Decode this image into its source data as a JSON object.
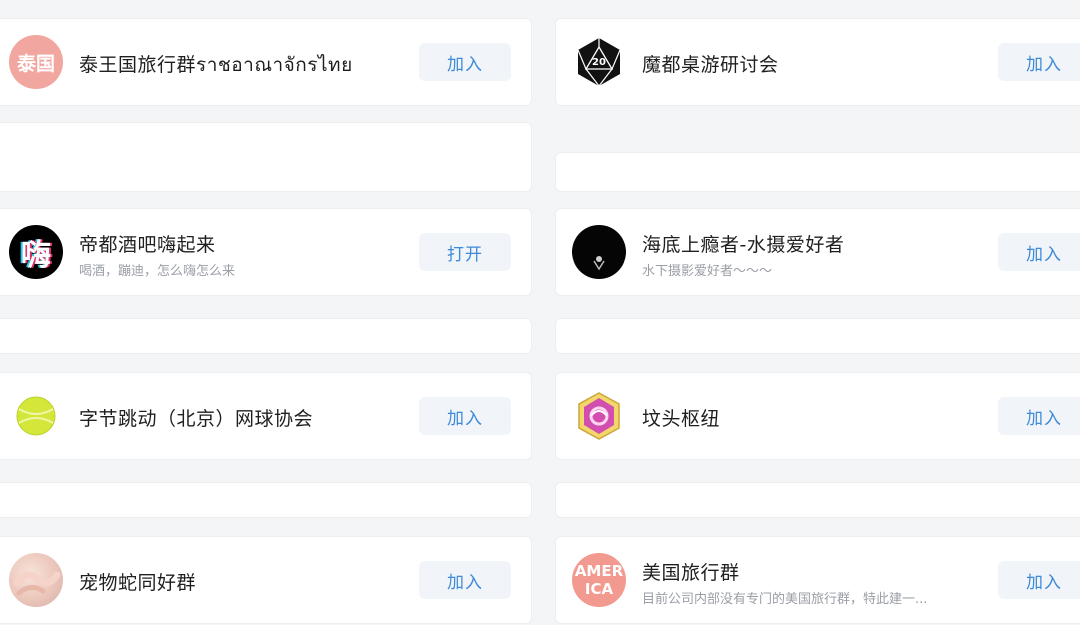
{
  "groups_left": [
    {
      "title": "泰王国旅行群ราชอาณาจักรไทย",
      "subtitle": "",
      "avatar_text": "泰国",
      "button": "加入"
    },
    {
      "title": "帝都酒吧嗨起来",
      "subtitle": "喝酒，蹦迪，怎么嗨怎么来",
      "avatar_text": "嗨",
      "button": "打开"
    },
    {
      "title": "字节跳动（北京）网球协会",
      "subtitle": "",
      "avatar_text": "",
      "button": "加入"
    },
    {
      "title": "宠物蛇同好群",
      "subtitle": "",
      "avatar_text": "",
      "button": "加入"
    }
  ],
  "groups_right": [
    {
      "title": "魔都桌游研讨会",
      "subtitle": "",
      "avatar_text": "20",
      "button": "加入"
    },
    {
      "title": "海底上瘾者-水摄爱好者",
      "subtitle": "水下摄影爱好者～～～",
      "avatar_text": "",
      "button": "加入"
    },
    {
      "title": "坟头枢纽",
      "subtitle": "",
      "avatar_text": "",
      "button": "加入"
    },
    {
      "title": "美国旅行群",
      "subtitle": "目前公司内部没有专门的美国旅行群，特此建一...",
      "avatar_text_line1": "AMER",
      "avatar_text_line2": "ICA",
      "button": "加入"
    }
  ],
  "colors": {
    "accent": "#3d8bd8",
    "button_bg": "#f1f4f8",
    "page_bg": "#f4f5f7"
  }
}
